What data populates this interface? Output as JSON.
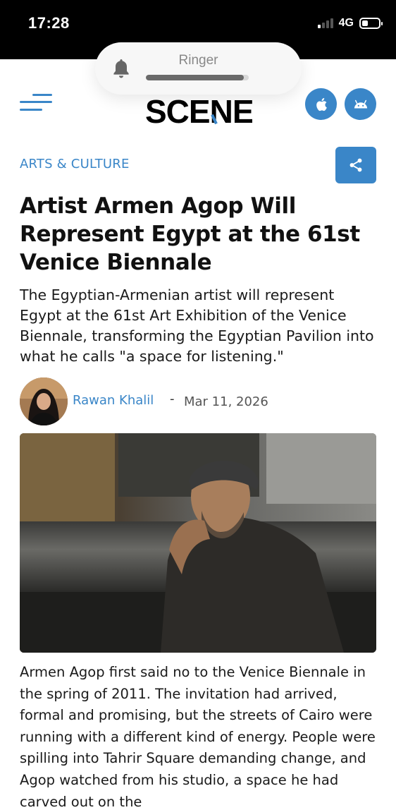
{
  "status_bar": {
    "time": "17:28",
    "network": "4G",
    "battery_level": 0.25
  },
  "ringer": {
    "label": "Ringer",
    "level": 0.95,
    "icon": "bell-icon"
  },
  "header": {
    "logo_top": "cairo",
    "logo_main_left": "SCE",
    "logo_main_right": "NE",
    "brand_color": "#3a86c8",
    "menu_icon": "hamburger-icon",
    "apple_icon": "apple-icon",
    "android_icon": "android-icon"
  },
  "article": {
    "category": "ARTS & CULTURE",
    "share_icon": "share-icon",
    "title": "Artist Armen Agop Will Represent Egypt at the 61st Venice Biennale",
    "subtitle": "The Egyptian-Armenian artist will represent Egypt at the 61st Art Exhibition of the Venice Biennale, transforming the Egyptian Pavilion into what he calls \"a space for listening.\"",
    "author": "Rawan Khalil",
    "separator": "-",
    "date": "Mar 11, 2026",
    "body": "Armen Agop first said no to the Venice Biennale in the spring of 2011. The invitation had arrived, formal and promising, but the streets of Cairo were running with a different kind of energy. People were spilling into Tahrir Square demanding change, and Agop watched from his studio, a space he had carved out on the"
  }
}
